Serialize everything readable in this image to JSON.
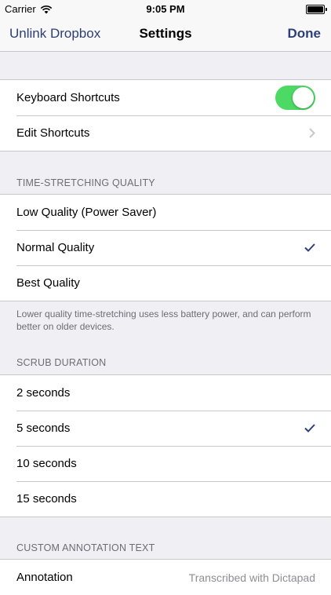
{
  "status_bar": {
    "carrier": "Carrier",
    "time": "9:05 PM"
  },
  "nav_bar": {
    "left_button": "Unlink Dropbox",
    "title": "Settings",
    "right_button": "Done"
  },
  "general": {
    "rows": [
      {
        "label": "Keyboard Shortcuts",
        "control": "toggle",
        "on": true
      },
      {
        "label": "Edit Shortcuts",
        "control": "chevron"
      }
    ]
  },
  "time_stretching": {
    "header": "TIME-STRETCHING QUALITY",
    "rows": [
      {
        "label": "Low Quality (Power Saver)",
        "selected": false
      },
      {
        "label": "Normal Quality",
        "selected": true
      },
      {
        "label": "Best Quality",
        "selected": false
      }
    ],
    "footer": "Lower quality time-stretching uses less battery power, and can perform better on older devices."
  },
  "scrub_duration": {
    "header": "SCRUB DURATION",
    "rows": [
      {
        "label": "2 seconds",
        "selected": false
      },
      {
        "label": "5 seconds",
        "selected": true
      },
      {
        "label": "10 seconds",
        "selected": false
      },
      {
        "label": "15 seconds",
        "selected": false
      }
    ]
  },
  "custom_annotation": {
    "header": "CUSTOM ANNOTATION TEXT",
    "rows": [
      {
        "label": "Annotation",
        "value": "Transcribed with Dictapad"
      }
    ]
  },
  "colors": {
    "accent": "#2e3e78",
    "toggle_on": "#4cd964",
    "background": "#efeff4",
    "separator": "#c8c7cc",
    "secondary_text": "#6d6d72"
  }
}
